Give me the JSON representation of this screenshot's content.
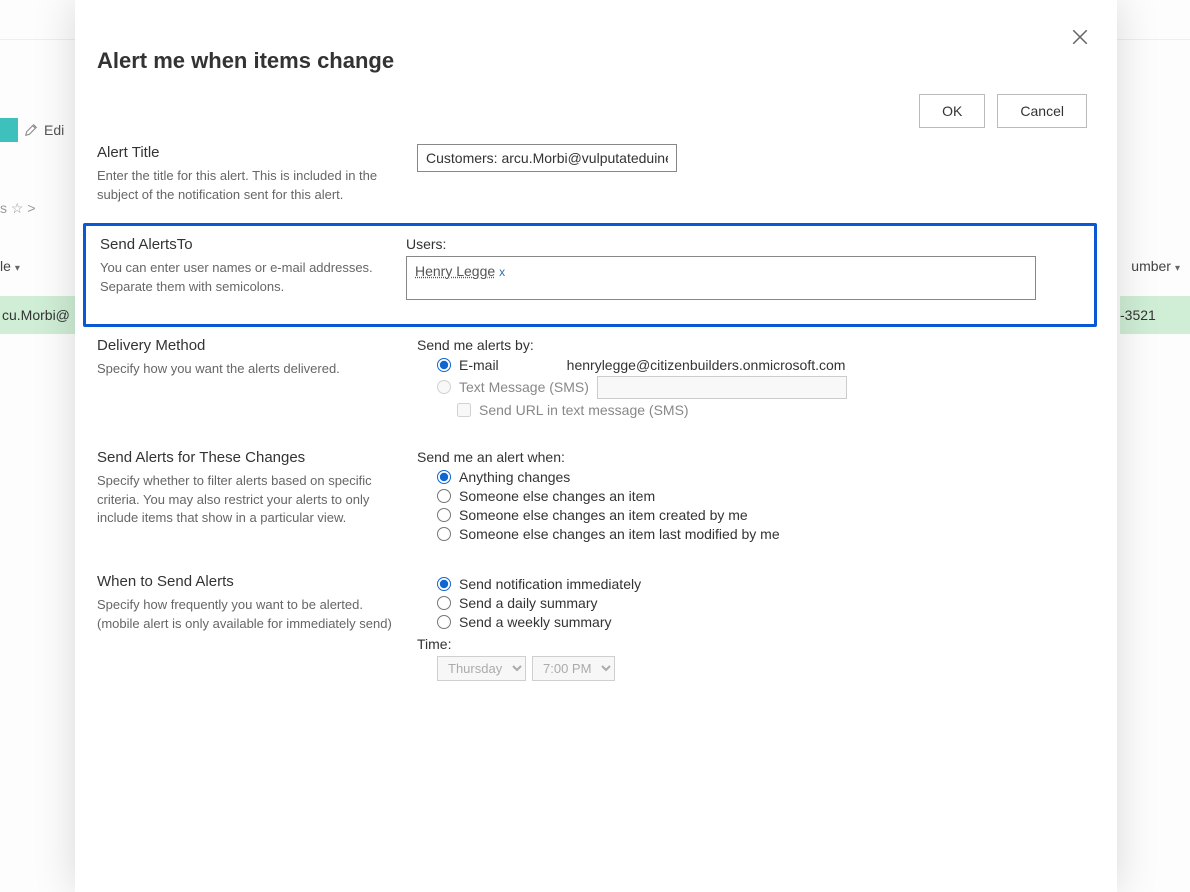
{
  "background": {
    "edit_label": "Edi",
    "star_row": "s  ☆  >",
    "left_col_header": "le",
    "right_col_header": "umber",
    "left_cell": "cu.Morbi@",
    "right_cell": "-3521"
  },
  "dialog": {
    "title": "Alert me when items change",
    "ok": "OK",
    "cancel": "Cancel"
  },
  "alert_title": {
    "heading": "Alert Title",
    "desc": "Enter the title for this alert. This is included in the subject of the notification sent for this alert.",
    "value": "Customers: arcu.Morbi@vulputateduinec."
  },
  "send_to": {
    "heading": "Send AlertsTo",
    "desc": "You can enter user names or e-mail addresses. Separate them with semicolons.",
    "users_label": "Users:",
    "person": "Henry Legge",
    "remove_glyph": "x"
  },
  "delivery": {
    "heading": "Delivery Method",
    "desc": "Specify how you want the alerts delivered.",
    "group_label": "Send me alerts by:",
    "email_label": "E-mail",
    "email_value": "henrylegge@citizenbuilders.onmicrosoft.com",
    "sms_label": "Text Message (SMS)",
    "url_check_label": "Send URL in text message (SMS)"
  },
  "changes": {
    "heading": "Send Alerts for These Changes",
    "desc": "Specify whether to filter alerts based on specific criteria. You may also restrict your alerts to only include items that show in a particular view.",
    "group_label": "Send me an alert when:",
    "opt1": "Anything changes",
    "opt2": "Someone else changes an item",
    "opt3": "Someone else changes an item created by me",
    "opt4": "Someone else changes an item last modified by me"
  },
  "when": {
    "heading": "When to Send Alerts",
    "desc": "Specify how frequently you want to be alerted. (mobile alert is only available for immediately send)",
    "opt1": "Send notification immediately",
    "opt2": "Send a daily summary",
    "opt3": "Send a weekly summary",
    "time_label": "Time:",
    "day": "Thursday",
    "hour": "7:00 PM"
  }
}
